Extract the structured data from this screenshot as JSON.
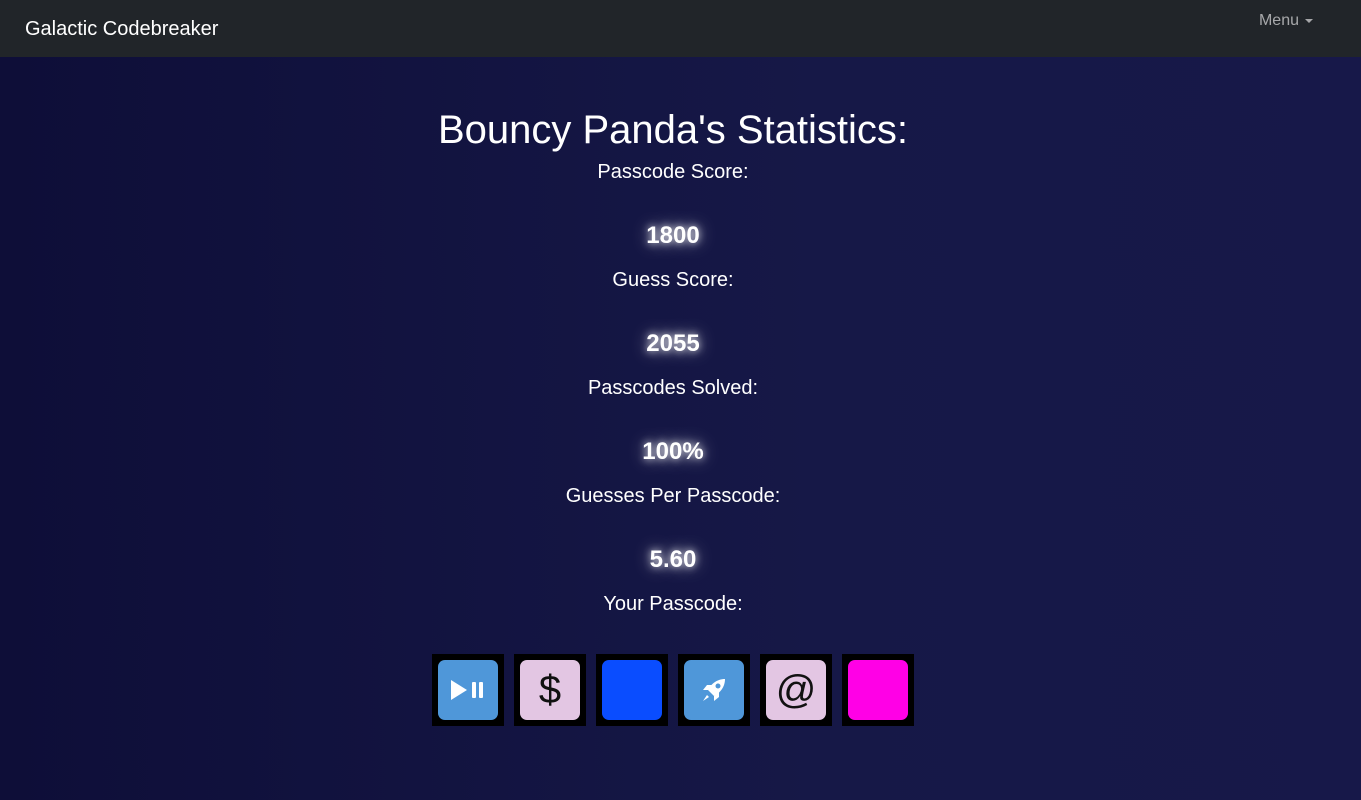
{
  "navbar": {
    "brand": "Galactic Codebreaker",
    "menu_label": "Menu"
  },
  "page": {
    "title": "Bouncy Panda's Statistics:"
  },
  "stats": [
    {
      "label": "Passcode Score:",
      "value": "1800"
    },
    {
      "label": "Guess Score:",
      "value": "2055"
    },
    {
      "label": "Passcodes Solved:",
      "value": "100%"
    },
    {
      "label": "Guesses Per Passcode:",
      "value": "5.60"
    }
  ],
  "passcode": {
    "label": "Your Passcode:",
    "tiles": [
      {
        "icon": "play-pause-icon",
        "color": "#4f97d9",
        "symbol": ""
      },
      {
        "icon": "dollar-icon",
        "color": "#e3c6e3",
        "symbol": "$"
      },
      {
        "icon": "blue-square",
        "color": "#0a4dff",
        "symbol": ""
      },
      {
        "icon": "rocket-icon",
        "color": "#4f97d9",
        "symbol": ""
      },
      {
        "icon": "at-sign-icon",
        "color": "#e3c6e3",
        "symbol": "@"
      },
      {
        "icon": "magenta-square",
        "color": "#ff00e6",
        "symbol": ""
      }
    ]
  },
  "colors": {
    "navbar_bg": "#212529",
    "background": "#141543",
    "text": "#ffffff"
  }
}
